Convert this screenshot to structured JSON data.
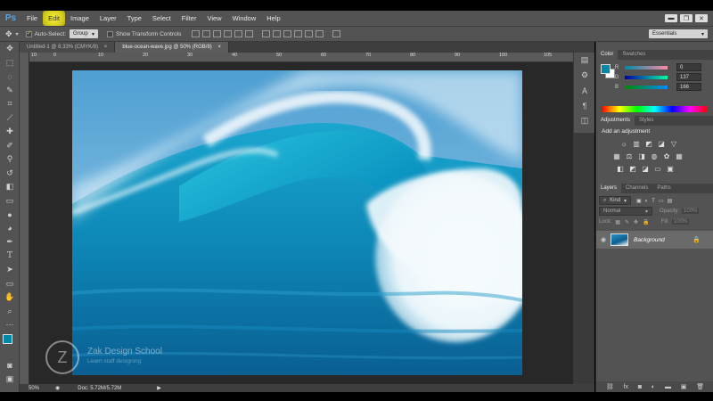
{
  "app": {
    "logo": "Ps"
  },
  "menu": [
    "File",
    "Edit",
    "Image",
    "Layer",
    "Type",
    "Select",
    "Filter",
    "View",
    "Window",
    "Help"
  ],
  "window_controls": {
    "minimize": "▬",
    "restore": "❐",
    "close": "✕"
  },
  "options_bar": {
    "auto_select_label": "Auto-Select:",
    "auto_select_value": "Group",
    "transform_label": "Show Transform Controls",
    "workspace": "Essentials"
  },
  "tabs": [
    {
      "label": "Untitled-1 @ 8.33% (CMYK/8)",
      "close": "×"
    },
    {
      "label": "blue-ocean-wave.jpg @ 50% (RGB/8)",
      "close": "×"
    }
  ],
  "ruler_ticks": [
    "10",
    "0",
    "10",
    "20",
    "30",
    "40",
    "50",
    "60",
    "70",
    "80",
    "90",
    "100",
    "105"
  ],
  "status": {
    "zoom": "50%",
    "doc": "Doc: 5.72M/5.72M"
  },
  "color_panel": {
    "tabs": [
      "Color",
      "Swatches"
    ],
    "r_label": "R",
    "g_label": "G",
    "b_label": "B",
    "r": "0",
    "g": "137",
    "b": "166",
    "foreground": "#0089a6"
  },
  "adjustments": {
    "tabs": [
      "Adjustments",
      "Styles"
    ],
    "title": "Add an adjustment"
  },
  "layers": {
    "tabs": [
      "Layers",
      "Channels",
      "Paths"
    ],
    "kind_label": "Kind",
    "blend_mode": "Normal",
    "opacity_label": "Opacity:",
    "opacity_value": "100%",
    "lock_label": "Lock:",
    "fill_label": "Fill:",
    "fill_value": "100%",
    "layer_name": "Background"
  },
  "watermark": {
    "initial": "Z",
    "title": "Zak Design School",
    "subtitle": "Learn staff designing"
  }
}
